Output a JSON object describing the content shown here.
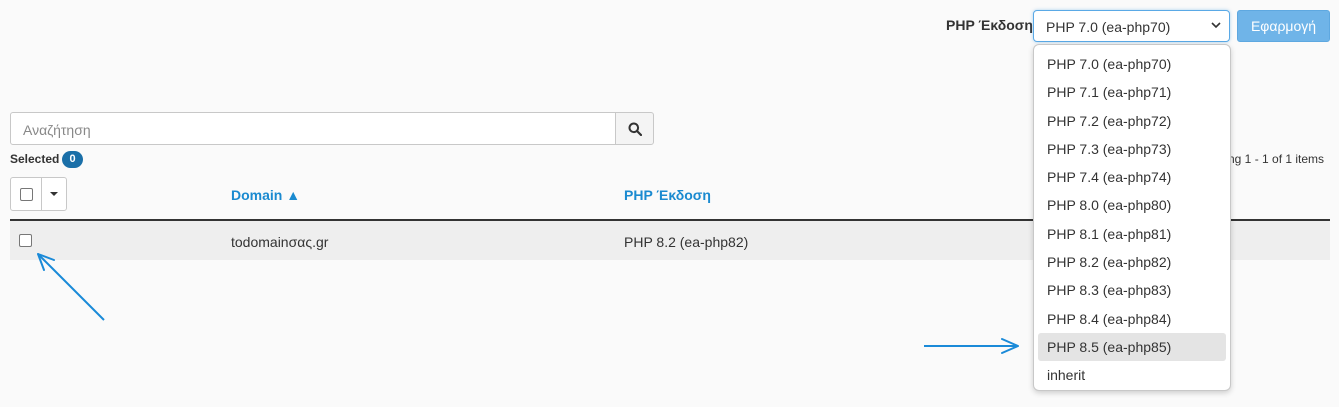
{
  "php_version": {
    "label": "PHP Έκδοση",
    "selected": "PHP 7.0 (ea-php70)",
    "apply_label": "Εφαρμογή",
    "highlighted_index": 10,
    "options": [
      "PHP 7.0 (ea-php70)",
      "PHP 7.1 (ea-php71)",
      "PHP 7.2 (ea-php72)",
      "PHP 7.3 (ea-php73)",
      "PHP 7.4 (ea-php74)",
      "PHP 8.0 (ea-php80)",
      "PHP 8.1 (ea-php81)",
      "PHP 8.2 (ea-php82)",
      "PHP 8.3 (ea-php83)",
      "PHP 8.4 (ea-php84)",
      "PHP 8.5 (ea-php85)",
      "inherit"
    ]
  },
  "search": {
    "placeholder": "Αναζήτηση",
    "icon": "search-icon"
  },
  "selection": {
    "label": "Selected",
    "count": "0"
  },
  "paging": {
    "text": "ng 1 - 1 of 1 items"
  },
  "table": {
    "columns": [
      "Domain ▲",
      "PHP Έκδοση"
    ],
    "rows": [
      {
        "domain": "todomainσας.gr",
        "php": "PHP 8.2 (ea-php82)"
      }
    ]
  },
  "colors": {
    "accent": "#1a8ad0",
    "apply_button": "#6fb4e8",
    "annotation_arrow": "#1a8ad8"
  }
}
